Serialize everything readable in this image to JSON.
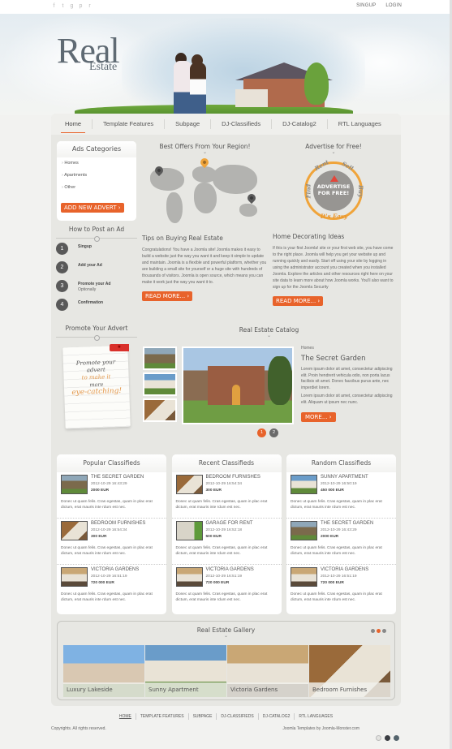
{
  "topbar": {
    "social_icons": [
      {
        "name": "facebook-icon",
        "glyph": "f"
      },
      {
        "name": "twitter-icon",
        "glyph": "t"
      },
      {
        "name": "google-plus-icon",
        "glyph": "g"
      },
      {
        "name": "pinterest-icon",
        "glyph": "p"
      },
      {
        "name": "rss-icon",
        "glyph": "r"
      }
    ],
    "signup": "SINGUP",
    "login": "LOGIN"
  },
  "logo": {
    "main": "Real",
    "sub": "Estate"
  },
  "nav": {
    "items": [
      "Home",
      "Template Features",
      "Subpage",
      "DJ-Classifieds",
      "DJ-Catalog2",
      "RTL Languages"
    ],
    "active": "Home"
  },
  "ads_categories": {
    "title": "Ads Categories",
    "items": [
      "Homes",
      "Apartments",
      "Other"
    ],
    "button": "ADD NEW ADVERT ›"
  },
  "how_to": {
    "title": "How to Post an Ad",
    "steps": [
      {
        "num": "1",
        "label": "Singup",
        "note": ""
      },
      {
        "num": "2",
        "label": "Add your Ad",
        "note": ""
      },
      {
        "num": "3",
        "label": "Promote your Ad",
        "note": "Optionally"
      },
      {
        "num": "4",
        "label": "Confirmation",
        "note": ""
      }
    ]
  },
  "promote": {
    "title": "Promote Your Advert",
    "note_lines": [
      "Promote your",
      "advert",
      "to make it",
      "more",
      "eye-catching!"
    ],
    "tag_glyph": "★"
  },
  "best_offers": {
    "title": "Best Offers From Your Region!"
  },
  "advertise": {
    "title": "Advertise for Free!",
    "badge_words": [
      "Rent",
      "Sell",
      "Find",
      "Buy",
      "It's Easy"
    ],
    "badge_core": [
      "ADVERTISE",
      "FOR FREE!"
    ]
  },
  "articles": [
    {
      "title": "Tips on Buying Real Estate",
      "body": "Congratulations! You have a Joomla site! Joomla makes it easy to build a website just the way you want it and keep it simple to update and maintain. Joomla is a flexible and powerful platform, whether you are building a small site for yourself or a huge site with hundreds of thousands of visitors. Joomla is open source, which means you can make it work just the way you want it to.",
      "button": "READ MORE... ›"
    },
    {
      "title": "Home Decorating Ideas",
      "body": "If this is your first Joomla! site or your first web site, you have come to the right place. Joomla will help you get your website up and running quickly and easily. Start off using your site by logging in using the administrator account you created when you installed Joomla. Explore the articles and other resources right here on your site data to learn more about how Joomla works. You'll also want to sign up for the Joomla Security",
      "button": "READ MORE... ›"
    }
  ],
  "catalog": {
    "title": "Real Estate Catalog",
    "category": "Homes",
    "item_title": "The Secret Garden",
    "para1": "Lorem ipsum dolor sit amet, consectetur adipiscing elit. Proin hendrerit vehicula odio, non porta lacus facilisis sit amet. Donec faucibus purus ante, nec imperdiet lorem.",
    "para2": "Lorem ipsum dolor sit amet, consectetur adipiscing elit. Aliquam ut ipsum nec nunc.",
    "button": "MORE... ›",
    "pages": [
      "1",
      "2"
    ],
    "active_page": "1"
  },
  "classifieds": [
    {
      "title": "Popular Classifieds",
      "items": [
        {
          "title": "THE SECRET GARDEN",
          "date": "2012-10-29 16:43:29",
          "price": "2000 EUR",
          "desc": "Donec ut quam felis. Cras egestas, quam in plac erat dictum, erat mauris inte rdum est nec.",
          "thumb": "garden"
        },
        {
          "title": "BEDROOM FURNISHES",
          "date": "2012-10-29 16:54:34",
          "price": "300 EUR",
          "desc": "Donec ut quam felis. Cras egestas, quam in plac erat dictum, erat mauris inte rdum est nec.",
          "thumb": "bedroom"
        },
        {
          "title": "VICTORIA GARDENS",
          "date": "2012-10-29 16:51:19",
          "price": "720 000 EUR",
          "desc": "Donec ut quam felis. Cras egestas, quam in plac erat dictum, erat mauris inte rdum est nec.",
          "thumb": "victoria"
        }
      ]
    },
    {
      "title": "Recent Classifieds",
      "items": [
        {
          "title": "BEDROOM FURNISHES",
          "date": "2012-10-29 16:54:34",
          "price": "300 EUR",
          "desc": "Donec ut quam felis. Cras egestas, quam in plac erat dictum, erat mauris inte rdum est nec.",
          "thumb": "bedroom"
        },
        {
          "title": "GARAGE FOR RENT",
          "date": "2012-10-29 16:52:18",
          "price": "500 EUR",
          "desc": "Donec ut quam felis. Cras egestas, quam in plac erat dictum, erat mauris inte rdum est nec.",
          "thumb": "garage"
        },
        {
          "title": "VICTORIA GARDENS",
          "date": "2012-10-29 16:51:19",
          "price": "720 000 EUR",
          "desc": "Donec ut quam felis. Cras egestas, quam in plac erat dictum, erat mauris inte rdum est nec.",
          "thumb": "victoria"
        }
      ]
    },
    {
      "title": "Random Classifieds",
      "items": [
        {
          "title": "SUNNY APARTMENT",
          "date": "2012-10-29 16:50:19",
          "price": "450 000 EUR",
          "desc": "Donec ut quam felis. Cras egestas, quam in plac erat dictum, erat mauris inte rdum est nec.",
          "thumb": "sunny"
        },
        {
          "title": "THE SECRET GARDEN",
          "date": "2012-10-29 16:43:29",
          "price": "2000 EUR",
          "desc": "Donec ut quam felis. Cras egestas, quam in plac erat dictum, erat mauris inte rdum est nec.",
          "thumb": "garden"
        },
        {
          "title": "VICTORIA GARDENS",
          "date": "2012-10-29 16:51:19",
          "price": "720 000 EUR",
          "desc": "Donec ut quam felis. Cras egestas, quam in plac erat dictum, erat mauris inte rdum est nec.",
          "thumb": "victoria"
        }
      ]
    }
  ],
  "gallery": {
    "title": "Real Estate Gallery",
    "active_dot": 1,
    "dot_count": 3,
    "items": [
      {
        "caption": "Luxury Lakeside",
        "thumb": "lakeside"
      },
      {
        "caption": "Sunny Apartment",
        "thumb": "sunny"
      },
      {
        "caption": "Victoria Gardens",
        "thumb": "victoria"
      },
      {
        "caption": "Bedroom Furnishes",
        "thumb": "bedroom"
      }
    ]
  },
  "footer": {
    "nav": [
      "HOME",
      "TEMPLATE FEATURES",
      "SUBPAGE",
      "DJ-CLASSIFIEDS",
      "DJ-CATALOG2",
      "RTL LANGUAGES"
    ],
    "active": "HOME",
    "copyright": "Copyrights. All rights reserved.",
    "credit": "Joomla Templates by Joomla-Monster.com",
    "style_swatches": [
      "#e3e3e0",
      "#3a3d42",
      "#55646c"
    ]
  },
  "colors": {
    "accent": "#e8632b",
    "badge_ring": "#f0a43a",
    "text": "#555555",
    "panel": "#e7e7e3"
  },
  "thumb_palettes": {
    "garden": "linear-gradient(#8fa7b8 0 30%,#7b6a4c 30% 75%,#5f8a3a 75%)",
    "bedroom": "linear-gradient(135deg,#9a6a3a 0 40%,#e9e3d6 40% 80%,#7a5a3a 80%)",
    "victoria": "linear-gradient(#c9a775 0 35%,#e8e2d6 35% 75%,#5a4a3a 75%)",
    "garage": "linear-gradient(90deg,#d8d4c8 0 70%,#5e9a3a 70%)",
    "sunny": "linear-gradient(#6a9cc9 0 30%,#e9e3d6 30% 70%,#5f8a3a 70%)",
    "lakeside": "linear-gradient(#7fb2e3 0 35%,#d9c8b2 35% 75%,#5a7a3a 75%)"
  }
}
